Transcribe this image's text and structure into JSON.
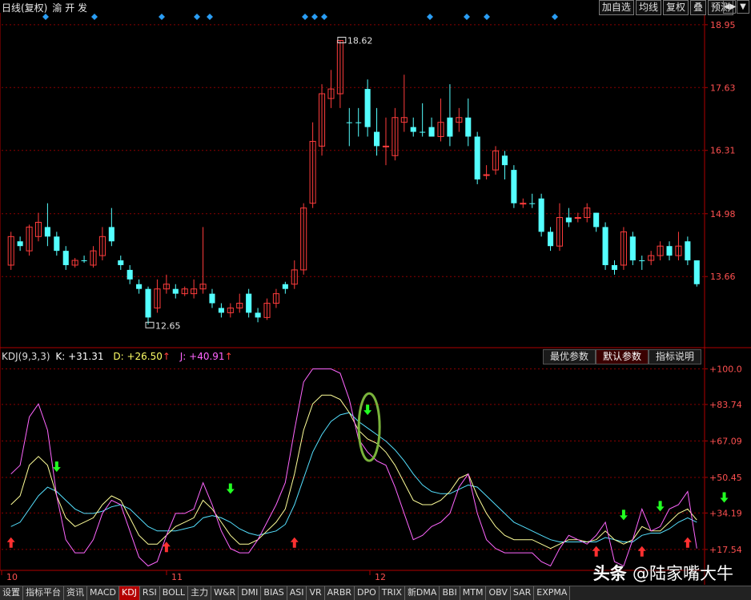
{
  "header": {
    "period_label": "日线(复权)",
    "symbol": "渝 开 发",
    "buttons": [
      "加自选",
      "均线",
      "复权",
      "叠",
      "预测"
    ],
    "mini_buttons": [
      "◀▶",
      "▼"
    ]
  },
  "price_axis": [
    "18.95",
    "17.63",
    "16.31",
    "14.98",
    "13.66"
  ],
  "markers": {
    "high": "18.62",
    "low": "12.65"
  },
  "indicator": {
    "name": "KDJ(9,3,3)",
    "k_label": "K: +31.31",
    "d_label": "D: +26.50",
    "j_label": "J: +40.91",
    "k_color": "#ffffff",
    "d_color": "#ffff66",
    "j_color": "#ff66ff",
    "axis": [
      "100.0",
      "83.74",
      "67.09",
      "50.45",
      "34.19",
      "17.54"
    ],
    "param_tabs": [
      "最优参数",
      "默认参数",
      "指标说明"
    ],
    "active_param_tab": 1
  },
  "date_labels": [
    "10",
    "11",
    "12"
  ],
  "bottom_tabs": [
    "设置",
    "指标平台",
    "资讯",
    "MACD",
    "KDJ",
    "RSI",
    "BOLL",
    "主力",
    "W&R",
    "DMI",
    "BIAS",
    "ASI",
    "VR",
    "ARBR",
    "DPO",
    "TRIX",
    "新DMA",
    "BBI",
    "MTM",
    "OBV",
    "SAR",
    "EXPMA"
  ],
  "active_bottom_tab": 4,
  "watermark": {
    "brand": "头条",
    "account": "@陆家嘴大牛"
  },
  "colors": {
    "up": "#ff3c3c",
    "down": "#54ffff",
    "grid": "#8b0000",
    "axis": "#b00000"
  },
  "chart_data": {
    "type": "candlestick",
    "price_ylim": [
      12.2,
      19.2
    ],
    "candles": [
      [
        13.9,
        14.5,
        13.8,
        14.6,
        1
      ],
      [
        14.4,
        14.3,
        14.2,
        14.5,
        0
      ],
      [
        14.2,
        14.7,
        14.1,
        14.75,
        1
      ],
      [
        14.5,
        14.8,
        14.4,
        15.0,
        1
      ],
      [
        14.7,
        14.5,
        14.3,
        15.2,
        0
      ],
      [
        14.5,
        14.2,
        14.1,
        14.6,
        0
      ],
      [
        14.2,
        13.9,
        13.8,
        14.3,
        0
      ],
      [
        13.9,
        14.0,
        13.85,
        14.05,
        1
      ],
      [
        14.0,
        14.0,
        13.95,
        14.1,
        0
      ],
      [
        13.9,
        14.2,
        13.85,
        14.3,
        1
      ],
      [
        14.1,
        14.5,
        14.0,
        14.7,
        1
      ],
      [
        14.7,
        14.4,
        14.3,
        15.1,
        0
      ],
      [
        14.0,
        13.9,
        13.8,
        14.1,
        0
      ],
      [
        13.8,
        13.6,
        13.5,
        13.9,
        0
      ],
      [
        13.5,
        13.4,
        13.3,
        13.6,
        0
      ],
      [
        13.4,
        12.8,
        12.65,
        13.45,
        0
      ],
      [
        13.0,
        13.4,
        12.9,
        13.6,
        1
      ],
      [
        13.4,
        13.5,
        13.3,
        13.7,
        1
      ],
      [
        13.4,
        13.3,
        13.2,
        13.5,
        0
      ],
      [
        13.3,
        13.4,
        13.25,
        13.45,
        1
      ],
      [
        13.3,
        13.4,
        13.2,
        13.6,
        1
      ],
      [
        13.4,
        13.5,
        13.3,
        14.7,
        1
      ],
      [
        13.3,
        13.1,
        13.0,
        13.4,
        0
      ],
      [
        13.0,
        12.9,
        12.8,
        13.1,
        0
      ],
      [
        12.9,
        13.0,
        12.8,
        13.1,
        1
      ],
      [
        13.0,
        13.1,
        12.9,
        13.3,
        1
      ],
      [
        13.3,
        12.9,
        12.8,
        13.4,
        0
      ],
      [
        12.9,
        12.8,
        12.7,
        13.0,
        0
      ],
      [
        12.8,
        13.1,
        12.75,
        13.2,
        1
      ],
      [
        13.1,
        13.3,
        13.0,
        13.4,
        1
      ],
      [
        13.4,
        13.5,
        13.3,
        13.55,
        0
      ],
      [
        13.5,
        13.8,
        13.4,
        14.0,
        1
      ],
      [
        13.8,
        15.1,
        13.7,
        15.2,
        1
      ],
      [
        15.2,
        16.5,
        15.1,
        16.9,
        1
      ],
      [
        16.4,
        17.5,
        16.2,
        17.7,
        1
      ],
      [
        17.4,
        17.6,
        17.2,
        18.0,
        1
      ],
      [
        17.5,
        18.62,
        17.2,
        18.62,
        1
      ],
      [
        16.9,
        16.9,
        16.4,
        17.2,
        0
      ],
      [
        16.9,
        16.9,
        16.6,
        17.2,
        0
      ],
      [
        17.6,
        16.8,
        16.6,
        17.8,
        0
      ],
      [
        16.7,
        16.4,
        16.2,
        17.2,
        0
      ],
      [
        16.4,
        16.4,
        16.0,
        17.0,
        1
      ],
      [
        16.2,
        17.0,
        16.1,
        17.2,
        1
      ],
      [
        17.0,
        16.9,
        16.7,
        17.9,
        1
      ],
      [
        16.8,
        16.7,
        16.6,
        17.0,
        0
      ],
      [
        16.7,
        16.7,
        16.6,
        17.3,
        0
      ],
      [
        16.8,
        16.6,
        16.6,
        17.0,
        0
      ],
      [
        16.6,
        16.9,
        16.5,
        17.4,
        1
      ],
      [
        17.0,
        16.6,
        16.4,
        17.7,
        0
      ],
      [
        16.9,
        17.0,
        16.7,
        17.2,
        1
      ],
      [
        17.0,
        16.6,
        16.4,
        17.4,
        0
      ],
      [
        16.6,
        15.7,
        15.6,
        16.7,
        0
      ],
      [
        15.8,
        15.8,
        15.7,
        16.0,
        1
      ],
      [
        15.9,
        16.3,
        15.8,
        16.4,
        1
      ],
      [
        16.2,
        16.0,
        15.7,
        16.3,
        0
      ],
      [
        15.9,
        15.2,
        15.1,
        16.0,
        0
      ],
      [
        15.2,
        15.2,
        15.1,
        15.3,
        1
      ],
      [
        15.2,
        15.2,
        15.1,
        15.4,
        0
      ],
      [
        15.3,
        14.6,
        14.5,
        15.4,
        0
      ],
      [
        14.6,
        14.3,
        14.2,
        14.7,
        0
      ],
      [
        14.3,
        14.9,
        14.2,
        15.2,
        1
      ],
      [
        14.9,
        14.8,
        14.7,
        15.1,
        0
      ],
      [
        14.9,
        14.9,
        14.8,
        15.0,
        1
      ],
      [
        14.9,
        15.1,
        14.8,
        15.2,
        1
      ],
      [
        15.0,
        14.7,
        14.6,
        15.0,
        0
      ],
      [
        14.7,
        13.9,
        13.8,
        14.8,
        0
      ],
      [
        13.9,
        13.8,
        13.7,
        14.0,
        0
      ],
      [
        13.9,
        14.6,
        13.8,
        14.7,
        1
      ],
      [
        14.5,
        14.0,
        13.9,
        14.6,
        0
      ],
      [
        14.0,
        14.0,
        13.8,
        14.1,
        0
      ],
      [
        14.0,
        14.1,
        13.9,
        14.2,
        1
      ],
      [
        14.1,
        14.3,
        14.0,
        14.4,
        1
      ],
      [
        14.3,
        14.1,
        14.0,
        14.4,
        0
      ],
      [
        14.1,
        14.3,
        14.0,
        14.6,
        1
      ],
      [
        14.4,
        14.0,
        13.9,
        14.5,
        0
      ],
      [
        14.0,
        13.5,
        13.45,
        14.0,
        0
      ]
    ],
    "kdj_ylim": [
      8,
      102
    ],
    "j": [
      52,
      56,
      78,
      84,
      72,
      42,
      22,
      16,
      16,
      22,
      34,
      40,
      38,
      26,
      14,
      10,
      12,
      24,
      34,
      34,
      36,
      48,
      38,
      26,
      18,
      16,
      16,
      22,
      30,
      38,
      48,
      72,
      94,
      100,
      100,
      100,
      98,
      86,
      68,
      62,
      58,
      56,
      46,
      34,
      22,
      24,
      28,
      30,
      34,
      46,
      52,
      34,
      22,
      18,
      16,
      16,
      16,
      16,
      12,
      10,
      18,
      24,
      22,
      20,
      24,
      30,
      12,
      10,
      22,
      36,
      26,
      28,
      36,
      38,
      44,
      18
    ],
    "k": [
      38,
      42,
      56,
      60,
      56,
      42,
      32,
      28,
      30,
      32,
      38,
      42,
      40,
      32,
      24,
      20,
      20,
      24,
      28,
      30,
      32,
      40,
      36,
      30,
      24,
      20,
      20,
      22,
      26,
      30,
      36,
      52,
      72,
      84,
      88,
      88,
      86,
      80,
      72,
      68,
      66,
      62,
      56,
      48,
      40,
      38,
      38,
      40,
      44,
      50,
      52,
      42,
      34,
      28,
      24,
      22,
      22,
      22,
      20,
      18,
      20,
      22,
      22,
      21,
      22,
      26,
      22,
      20,
      22,
      28,
      26,
      26,
      30,
      34,
      36,
      31
    ],
    "d": [
      28,
      30,
      36,
      42,
      46,
      44,
      40,
      36,
      34,
      34,
      35,
      37,
      38,
      36,
      32,
      28,
      26,
      26,
      26,
      27,
      28,
      32,
      33,
      32,
      30,
      27,
      25,
      24,
      25,
      26,
      29,
      38,
      50,
      62,
      70,
      76,
      79,
      80,
      76,
      73,
      70,
      67,
      63,
      58,
      52,
      47,
      44,
      43,
      43,
      45,
      47,
      46,
      42,
      38,
      34,
      30,
      28,
      26,
      24,
      22,
      21,
      21,
      21,
      21,
      21,
      23,
      22,
      21,
      21,
      24,
      25,
      25,
      27,
      30,
      32,
      30
    ]
  }
}
